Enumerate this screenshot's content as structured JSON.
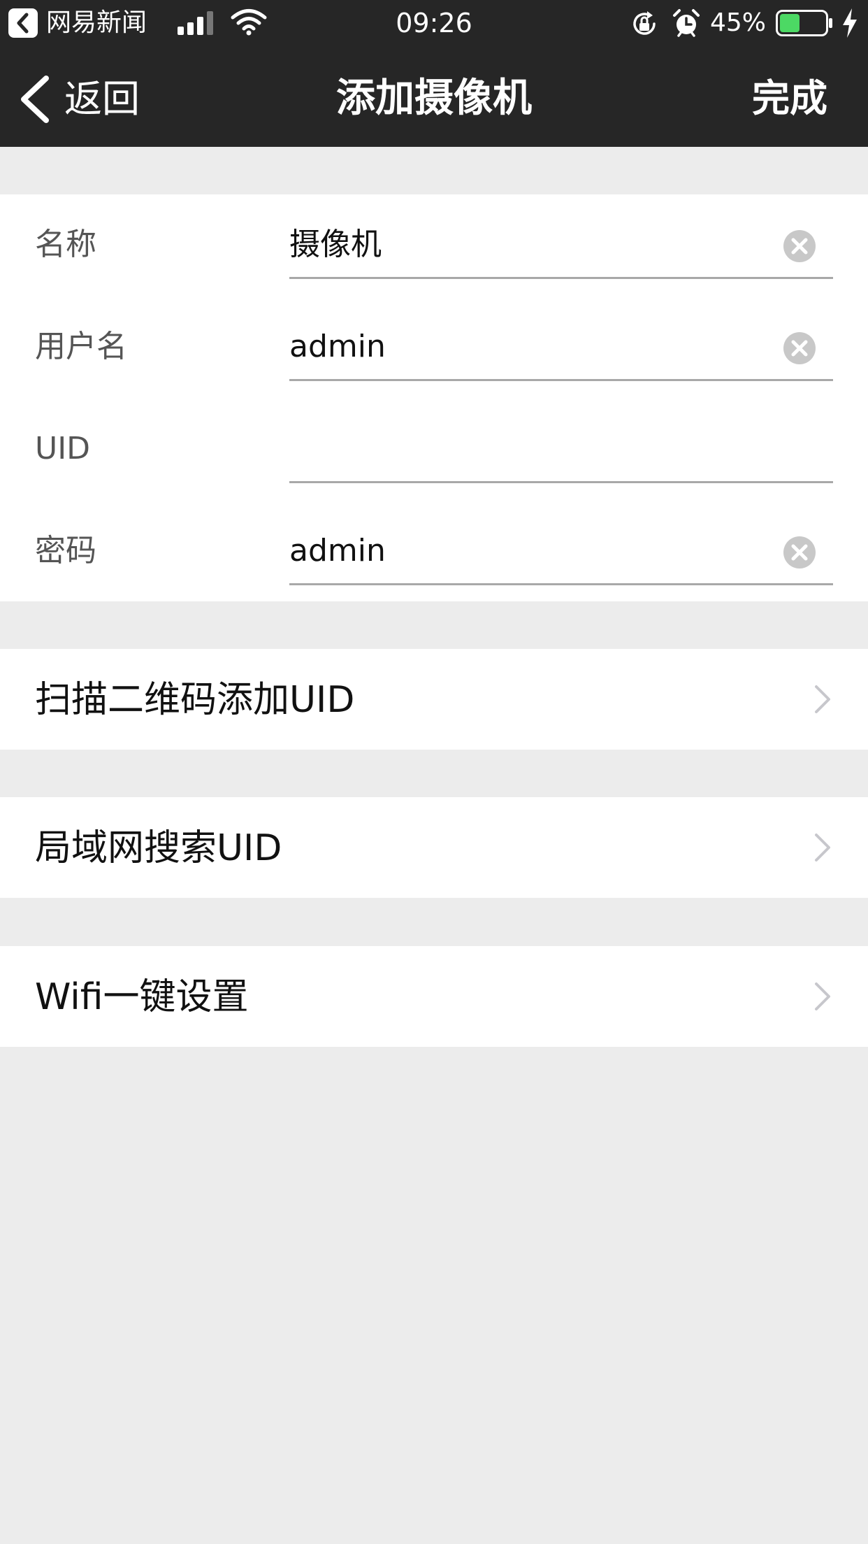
{
  "status_bar": {
    "back_app_name": "网易新闻",
    "time": "09:26",
    "battery_percent": "45%",
    "battery_level": 0.45,
    "icons": [
      "back-app-icon",
      "signal-icon",
      "wifi-icon",
      "rotation-lock-icon",
      "alarm-icon",
      "battery-icon",
      "charging-icon"
    ]
  },
  "nav": {
    "back_label": "返回",
    "title": "添加摄像机",
    "done_label": "完成",
    "back_icon": "chevron-left-icon"
  },
  "form": {
    "fields": [
      {
        "label": "名称",
        "value": "摄像机",
        "has_clear": true
      },
      {
        "label": "用户名",
        "value": "admin",
        "has_clear": true
      },
      {
        "label": "UID",
        "value": "",
        "has_clear": false
      },
      {
        "label": "密码",
        "value": "admin",
        "has_clear": true
      }
    ],
    "clear_icon": "clear-circle-icon"
  },
  "actions": [
    {
      "label": "扫描二维码添加UID",
      "icon": "chevron-right-icon"
    },
    {
      "label": "局域网搜索UID",
      "icon": "chevron-right-icon"
    },
    {
      "label": "Wifi一键设置",
      "icon": "chevron-right-icon"
    }
  ],
  "colors": {
    "bar_background": "#262626",
    "page_background": "#ececec",
    "card_background": "#ffffff",
    "battery_fill": "#4cd964",
    "underline": "#a8a8a8",
    "chevron": "#c7c7cc",
    "clear_icon": "#c8c8c8"
  }
}
